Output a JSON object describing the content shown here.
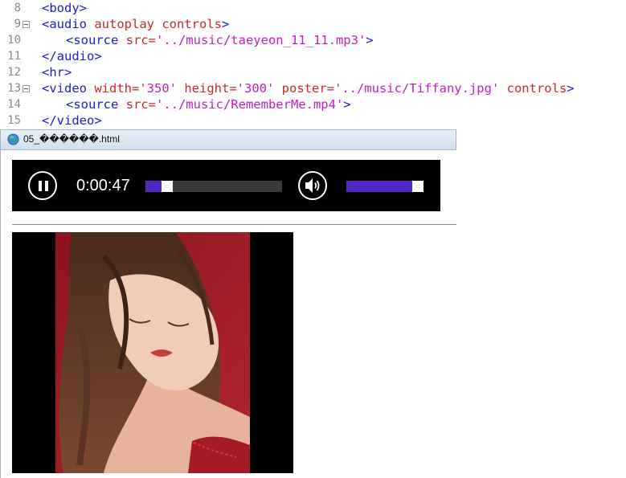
{
  "editor": {
    "lines": [
      {
        "num": "8",
        "folded": false,
        "indent": false,
        "tokens": [
          [
            "tag",
            "<body>"
          ]
        ]
      },
      {
        "num": "9",
        "folded": true,
        "indent": false,
        "tokens": [
          [
            "tag",
            "<audio "
          ],
          [
            "attr",
            "autoplay controls"
          ],
          [
            "tag",
            ">"
          ]
        ]
      },
      {
        "num": "10",
        "folded": false,
        "indent": true,
        "tokens": [
          [
            "tag",
            "<source "
          ],
          [
            "attr",
            "src="
          ],
          [
            "val",
            "'../music/taeyeon_11_11.mp3'"
          ],
          [
            "tag",
            ">"
          ]
        ]
      },
      {
        "num": "11",
        "folded": false,
        "indent": false,
        "tokens": [
          [
            "tag",
            "</audio>"
          ]
        ]
      },
      {
        "num": "12",
        "folded": false,
        "indent": false,
        "tokens": [
          [
            "tag",
            "<hr>"
          ]
        ]
      },
      {
        "num": "13",
        "folded": true,
        "indent": false,
        "tokens": [
          [
            "tag",
            "<video "
          ],
          [
            "attr",
            "width="
          ],
          [
            "val",
            "'350'"
          ],
          [
            "attr",
            " height="
          ],
          [
            "val",
            "'300'"
          ],
          [
            "attr",
            " poster="
          ],
          [
            "val",
            "'../music/Tiffany.jpg'"
          ],
          [
            "attr",
            " controls"
          ],
          [
            "tag",
            ">"
          ]
        ]
      },
      {
        "num": "14",
        "folded": false,
        "indent": true,
        "tokens": [
          [
            "tag",
            "<source "
          ],
          [
            "attr",
            "src="
          ],
          [
            "val",
            "'../music/RememberMe.mp4'"
          ],
          [
            "tag",
            ">"
          ]
        ]
      },
      {
        "num": "15",
        "folded": false,
        "indent": false,
        "tokens": [
          [
            "tag",
            "</video>"
          ]
        ]
      }
    ]
  },
  "browser": {
    "title": "05_������.html",
    "icon": "globe-icon"
  },
  "audio_player": {
    "time": "0:00:47",
    "state": "playing",
    "progress_fraction": 0.12,
    "volume_fraction": 0.88,
    "play_icon": "pause-icon",
    "volume_icon": "speaker-volume-icon"
  },
  "video_player": {
    "poster_subject": "woman-portrait-image"
  },
  "colors": {
    "tag": "#1c1ccc",
    "attr": "#c92828",
    "value": "#c21ec2",
    "player_accent": "#5125c2",
    "player_bg": "#000000"
  }
}
